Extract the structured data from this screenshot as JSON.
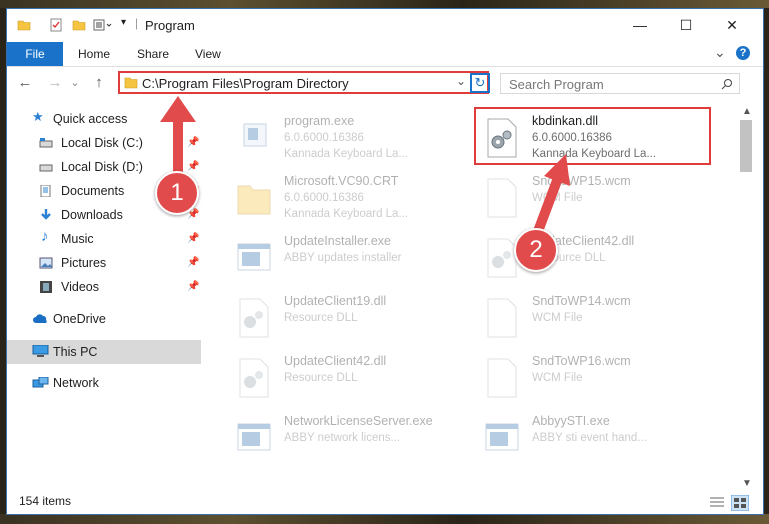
{
  "window": {
    "title": "Program",
    "controls": {
      "minimize": "—",
      "maximize": "☐",
      "close": "✕"
    }
  },
  "ribbon": {
    "tabs": [
      "File",
      "Home",
      "Share",
      "View"
    ],
    "collapse": "⌄",
    "help": "?"
  },
  "navbar": {
    "back": "←",
    "forward": "→",
    "dropdown": "⌄",
    "up": "↑",
    "address": "C:\\Program Files\\Program Directory",
    "address_dropdown": "⌄",
    "refresh": "↻",
    "search_placeholder": "Search Program"
  },
  "sidebar": {
    "items": [
      {
        "label": "Quick access",
        "icon": "star-icon",
        "pinned": false
      },
      {
        "label": "Local Disk (C:)",
        "icon": "drive-icon",
        "pinned": true
      },
      {
        "label": "Local Disk (D:)",
        "icon": "drive-icon",
        "pinned": true
      },
      {
        "label": "Documents",
        "icon": "documents-icon",
        "pinned": true
      },
      {
        "label": "Downloads",
        "icon": "download-icon",
        "pinned": true
      },
      {
        "label": "Music",
        "icon": "music-icon",
        "pinned": true
      },
      {
        "label": "Pictures",
        "icon": "pictures-icon",
        "pinned": true
      },
      {
        "label": "Videos",
        "icon": "videos-icon",
        "pinned": true
      },
      {
        "label": "OneDrive",
        "icon": "cloud-icon",
        "pinned": false
      },
      {
        "label": "This PC",
        "icon": "pc-icon",
        "pinned": false,
        "selected": true
      },
      {
        "label": "Network",
        "icon": "network-icon",
        "pinned": false
      }
    ]
  },
  "files": [
    {
      "name": "program.exe",
      "version": "6.0.6000.16386",
      "desc": "Kannada Keyboard La...",
      "icon": "exe-icon"
    },
    {
      "name": "kbdinkan.dll",
      "version": "6.0.6000.16386",
      "desc": "Kannada Keyboard La...",
      "icon": "dll-gear-icon"
    },
    {
      "name": "Microsoft.VC90.CRT",
      "version": "6.0.6000.16386",
      "desc": "Kannada Keyboard La...",
      "icon": "folder-icon"
    },
    {
      "name": "SndToWP15.wcm",
      "version": "WCM File",
      "desc": "",
      "icon": "blank-file-icon"
    },
    {
      "name": "UpdateInstaller.exe",
      "version": "ABBY updates installer",
      "desc": "",
      "icon": "window-exe-icon"
    },
    {
      "name": "UpdateClient42.dll",
      "version": "Resource DLL",
      "desc": "",
      "icon": "dll-gear-icon"
    },
    {
      "name": "UpdateClient19.dll",
      "version": "Resource DLL",
      "desc": "",
      "icon": "dll-gear-icon"
    },
    {
      "name": "SndToWP14.wcm",
      "version": "WCM File",
      "desc": "",
      "icon": "blank-file-icon"
    },
    {
      "name": "UpdateClient42.dll",
      "version": "Resource DLL",
      "desc": "",
      "icon": "dll-gear-icon"
    },
    {
      "name": "SndToWP16.wcm",
      "version": "WCM File",
      "desc": "",
      "icon": "blank-file-icon"
    },
    {
      "name": "NetworkLicenseServer.exe",
      "version": "ABBY network licens...",
      "desc": "",
      "icon": "window-exe-icon"
    },
    {
      "name": "AbbyySTI.exe",
      "version": "ABBY sti event hand...",
      "desc": "",
      "icon": "window-exe-icon"
    }
  ],
  "status": {
    "count": "154 items"
  },
  "annotations": {
    "step1": "1",
    "step2": "2"
  },
  "colors": {
    "accent": "#1a73c8",
    "highlight": "#e03c3c",
    "badge": "#e24b4b"
  }
}
